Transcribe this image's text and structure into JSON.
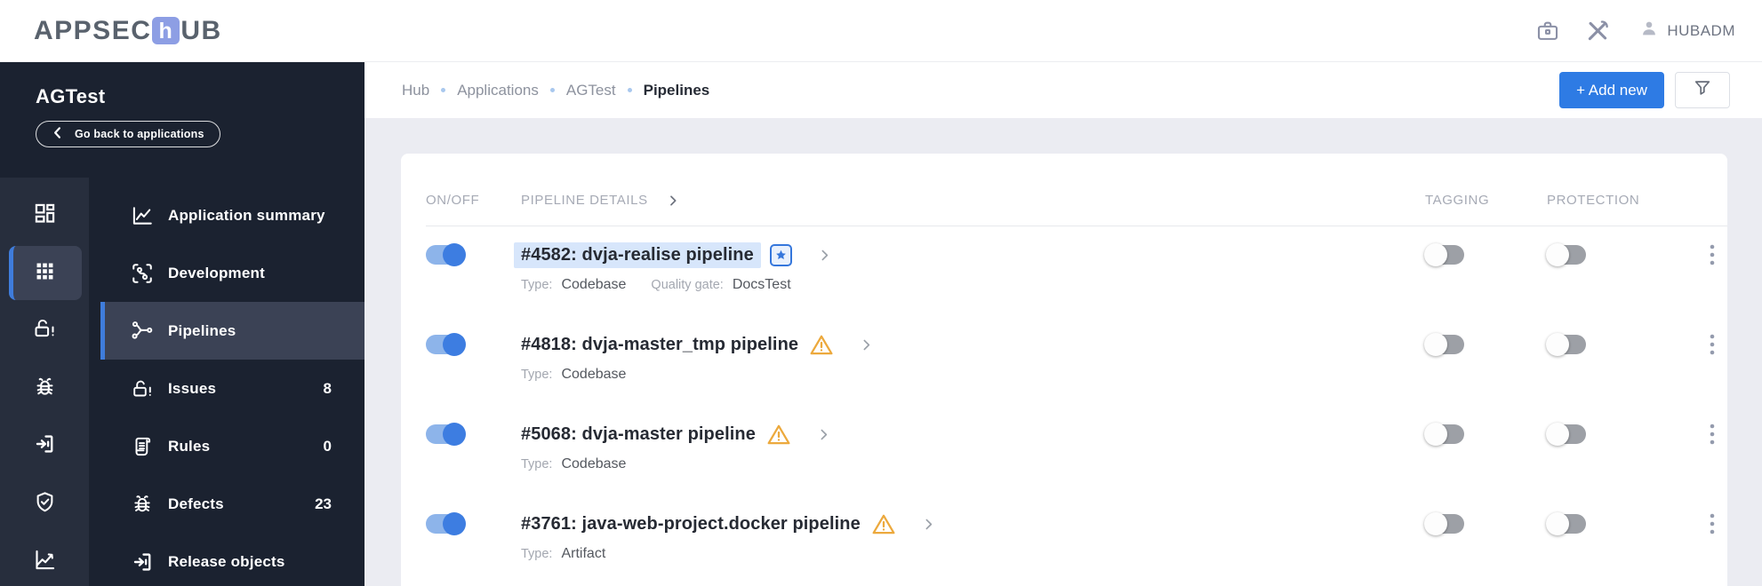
{
  "header": {
    "logo_pre": "APPSEC",
    "logo_mid": "h",
    "logo_post": "UB",
    "username": "HUBADM"
  },
  "sidebar": {
    "title": "AGTest",
    "back_label": "Go back to applications",
    "menu": [
      {
        "label": "Application summary"
      },
      {
        "label": "Development"
      },
      {
        "label": "Pipelines",
        "selected": true
      },
      {
        "label": "Issues",
        "badge": "8"
      },
      {
        "label": "Rules",
        "badge": "0"
      },
      {
        "label": "Defects",
        "badge": "23"
      },
      {
        "label": "Release objects"
      }
    ]
  },
  "breadcrumb": [
    "Hub",
    "Applications",
    "AGTest",
    "Pipelines"
  ],
  "toolbar": {
    "add_new_label": "+ Add new"
  },
  "table": {
    "col_onoff": "ON/OFF",
    "col_details": "PIPELINE DETAILS",
    "col_tagging": "TAGGING",
    "col_protection": "PROTECTION",
    "type_label": "Type:",
    "quality_gate_label": "Quality gate:",
    "rows": [
      {
        "title": "#4582: dvja-realise pipeline",
        "enabled": true,
        "starred": true,
        "highlighted": true,
        "type": "Codebase",
        "quality_gate": "DocsTest",
        "tagging": false,
        "protection": false
      },
      {
        "title": "#4818: dvja-master_tmp pipeline",
        "enabled": true,
        "warning": true,
        "type": "Codebase",
        "tagging": false,
        "protection": false
      },
      {
        "title": "#5068: dvja-master pipeline",
        "enabled": true,
        "warning": true,
        "type": "Codebase",
        "tagging": false,
        "protection": false
      },
      {
        "title": "#3761: java-web-project.docker pipeline",
        "enabled": true,
        "warning": true,
        "type": "Artifact",
        "tagging": false,
        "protection": false
      }
    ]
  },
  "colors": {
    "accent_blue": "#2e7be4",
    "toggle_on_track": "#8db4ea",
    "toggle_on_knob": "#3d7de1",
    "warning_orange": "#eca93d",
    "highlight_blue": "#d7e6fb",
    "sidebar_dark": "#1b2230",
    "sidebar_rail": "#272e3d",
    "sidebar_selected": "#3b4255"
  }
}
